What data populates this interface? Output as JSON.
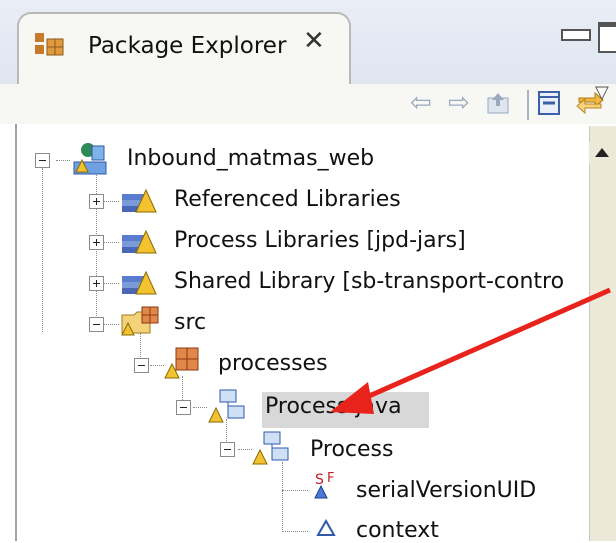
{
  "view": {
    "title": "Package Explorer",
    "close_glyph": "✕"
  },
  "toolbar": {
    "back_glyph": "⇦",
    "forward_glyph": "⇨",
    "menu_glyph": "▽"
  },
  "tree": {
    "items": [
      {
        "label": "Inbound_matmas_web",
        "icon": "web-project-icon",
        "state": "expanded"
      },
      {
        "label": "Referenced Libraries",
        "icon": "library-icon",
        "state": "collapsed"
      },
      {
        "label": "Process Libraries [jpd-jars]",
        "icon": "library-icon",
        "state": "collapsed"
      },
      {
        "label": "Shared Library [sb-transport-contro",
        "icon": "library-icon",
        "state": "collapsed"
      },
      {
        "label": "src",
        "icon": "source-folder-icon",
        "state": "expanded"
      },
      {
        "label": "processes",
        "icon": "package-icon",
        "state": "expanded"
      },
      {
        "label": "Process.java",
        "icon": "java-file-icon",
        "state": "expanded",
        "selected": true
      },
      {
        "label": "Process",
        "icon": "class-icon",
        "state": "expanded"
      },
      {
        "label": "serialVersionUID",
        "icon": "static-final-field-icon"
      },
      {
        "label": "context",
        "icon": "field-icon"
      }
    ]
  },
  "colors": {
    "annotation_arrow": "#e8231c",
    "selection": "#d8d8d8"
  }
}
